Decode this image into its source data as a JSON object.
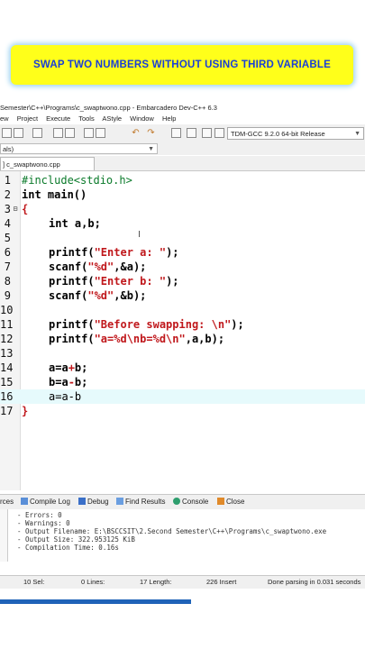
{
  "banner": {
    "text": "SWAP TWO NUMBERS WITHOUT USING THIRD VARIABLE"
  },
  "window": {
    "title": "Semester\\C++\\Programs\\c_swaptwono.cpp - Embarcadero Dev-C++ 6.3"
  },
  "menu": [
    "ew",
    "Project",
    "Execute",
    "Tools",
    "AStyle",
    "Window",
    "Help"
  ],
  "toolbar": {
    "compiler": "TDM-GCC 9.2.0 64-bit Release"
  },
  "scope": {
    "value": "als)"
  },
  "tab": {
    "label": "] c_swaptwono.cpp"
  },
  "editor": {
    "line_numbers": [
      "1",
      "2",
      "3",
      "4",
      "5",
      "6",
      "7",
      "8",
      "9",
      "10",
      "11",
      "12",
      "13",
      "14",
      "15",
      "16",
      "17"
    ],
    "code": {
      "l1": "#include<stdio.h>",
      "l2_kw": "int",
      "l2_rest": " main()",
      "l3": "{",
      "l4_kw": "int",
      "l4_rest": " a,b;",
      "l6_fn": "printf(",
      "l6_str": "\"Enter a: \"",
      "l6_end": ");",
      "l7_fn": "scanf(",
      "l7_str": "\"%d\"",
      "l7_end": ",&a);",
      "l8_fn": "printf(",
      "l8_str": "\"Enter b: \"",
      "l8_end": ");",
      "l9_fn": "scanf(",
      "l9_str": "\"%d\"",
      "l9_end": ",&b);",
      "l11_fn": "printf(",
      "l11_str": "\"Before swapping: \\n\"",
      "l11_end": ");",
      "l12_fn": "printf(",
      "l12_str": "\"a=%d\\nb=%d\\n\"",
      "l12_end": ",a,b);",
      "l14_a": "a=a",
      "l14_op": "+",
      "l14_b": "b;",
      "l15_a": "b=a",
      "l15_op": "-",
      "l15_b": "b;",
      "l16": "a=a-b",
      "l17": "}"
    }
  },
  "bottom_tabs": [
    "rces",
    "Compile Log",
    "Debug",
    "Find Results",
    "Console",
    "Close"
  ],
  "compile_log": [
    "- Errors: 0",
    "- Warnings: 0",
    "- Output Filename: E:\\BSCCSIT\\2.Second Semester\\C++\\Programs\\c_swaptwono.exe",
    "- Output Size: 322.953125 KiB",
    "- Compilation Time: 0.16s"
  ],
  "status": {
    "sel": "10 Sel:",
    "lines": "0 Lines:",
    "length": "17 Length:",
    "insert": "226 Insert",
    "parse": "Done parsing in 0.031 seconds"
  },
  "colors": {
    "banner_bg": "#ffff1a",
    "banner_text": "#1a3fd6",
    "string": "#c0181c",
    "preprocessor": "#0a7a2a",
    "highlight_line": "#e6fafc"
  }
}
